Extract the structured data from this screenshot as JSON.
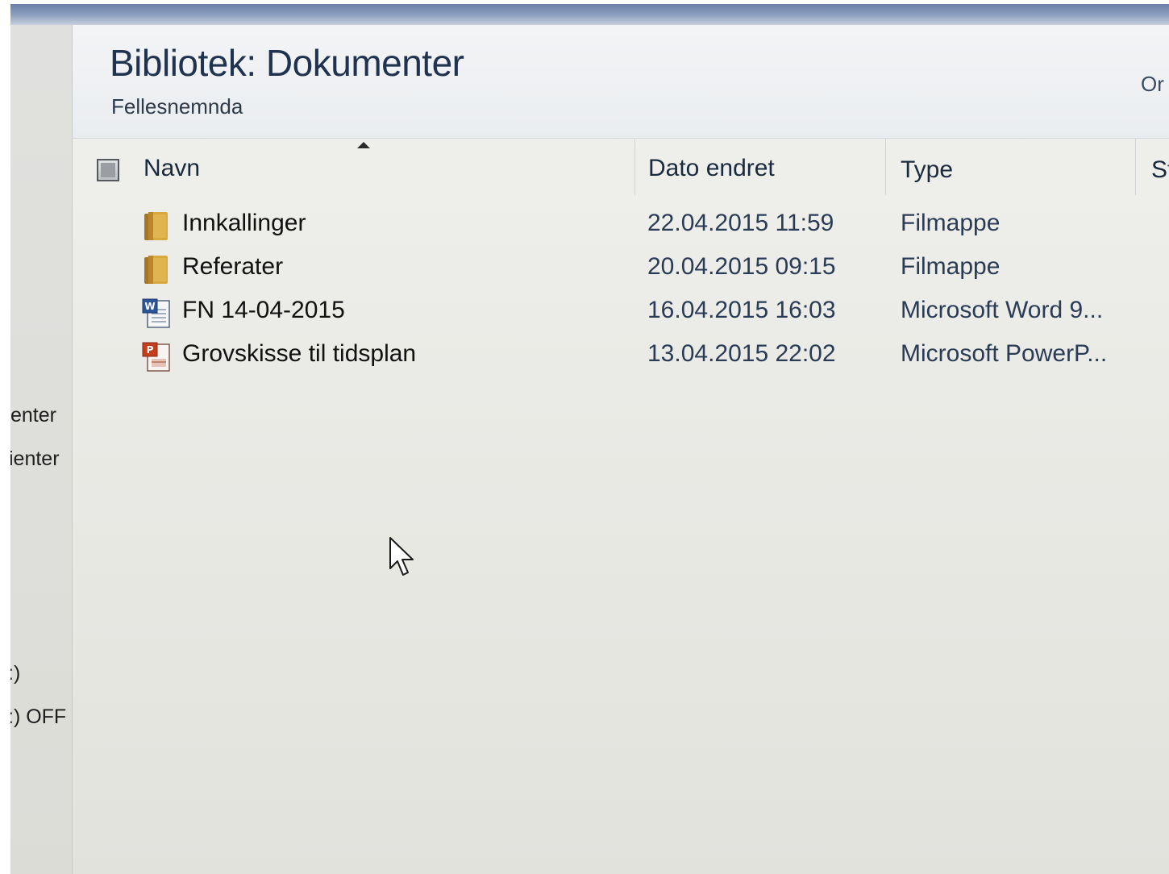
{
  "nav": {
    "items": [
      "enter",
      "ienter",
      ":)",
      ":) OFF"
    ]
  },
  "header": {
    "title": "Bibliotek: Dokumenter",
    "subtitle": "Fellesnemnda",
    "arrange_label": "Or"
  },
  "columns": {
    "name": "Navn",
    "date": "Dato endret",
    "type": "Type",
    "size": "St"
  },
  "files": [
    {
      "name": "Innkallinger",
      "date": "22.04.2015 11:59",
      "type": "Filmappe",
      "icon": "folder-icon"
    },
    {
      "name": "Referater",
      "date": "20.04.2015 09:15",
      "type": "Filmappe",
      "icon": "folder-icon"
    },
    {
      "name": "FN 14-04-2015",
      "date": "16.04.2015 16:03",
      "type": "Microsoft Word 9...",
      "icon": "word-document-icon"
    },
    {
      "name": "Grovskisse til tidsplan",
      "date": "13.04.2015 22:02",
      "type": "Microsoft PowerP...",
      "icon": "powerpoint-document-icon"
    }
  ],
  "colors": {
    "title": "#1f3351",
    "folder": "#c8962e",
    "word": "#2b579a",
    "powerpoint": "#c43e1c"
  }
}
